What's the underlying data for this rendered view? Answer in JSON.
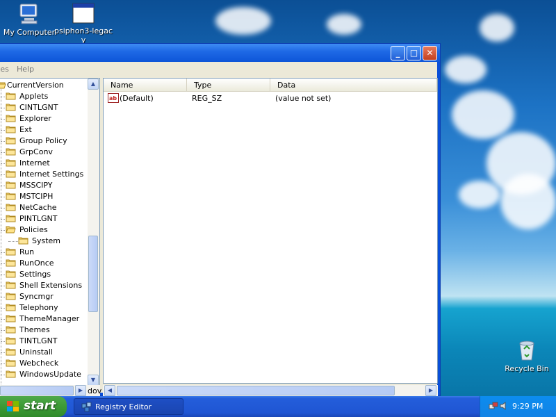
{
  "desktop": {
    "icons": [
      {
        "label": "My Computer"
      },
      {
        "label": "psiphon3-legac"
      },
      {
        "label": "y"
      },
      {
        "label": "Recycle Bin"
      }
    ]
  },
  "window": {
    "title": "",
    "buttons": {
      "minimize": "_",
      "maximize": "□",
      "close": "✕"
    },
    "menu": {
      "item_partial": "tes",
      "help": "Help"
    }
  },
  "tree": {
    "root": "CurrentVersion",
    "items": [
      "Applets",
      "CINTLGNT",
      "Explorer",
      "Ext",
      "Group Policy",
      "GrpConv",
      "Internet",
      "Internet Settings",
      "MSSCIPY",
      "MSTCIPH",
      "NetCache",
      "PINTLGNT",
      "Policies",
      "System",
      "Run",
      "RunOnce",
      "Settings",
      "Shell Extensions",
      "Syncmgr",
      "Telephony",
      "ThemeManager",
      "Themes",
      "TINTLGNT",
      "Uninstall",
      "Webcheck",
      "WindowsUpdate"
    ],
    "status_fragment": "dov"
  },
  "list": {
    "columns": [
      "Name",
      "Type",
      "Data"
    ],
    "rows": [
      {
        "name": "(Default)",
        "type": "REG_SZ",
        "data": "(value not set)"
      }
    ]
  },
  "taskbar": {
    "start_label": "start",
    "task_label": "Registry Editor",
    "clock": "9:29 PM"
  },
  "colors": {
    "titlebar": "#0d55d8",
    "taskbar": "#245edb",
    "start": "#3c9a36",
    "tray": "#0c8cef",
    "window_bg": "#ece9d8"
  }
}
